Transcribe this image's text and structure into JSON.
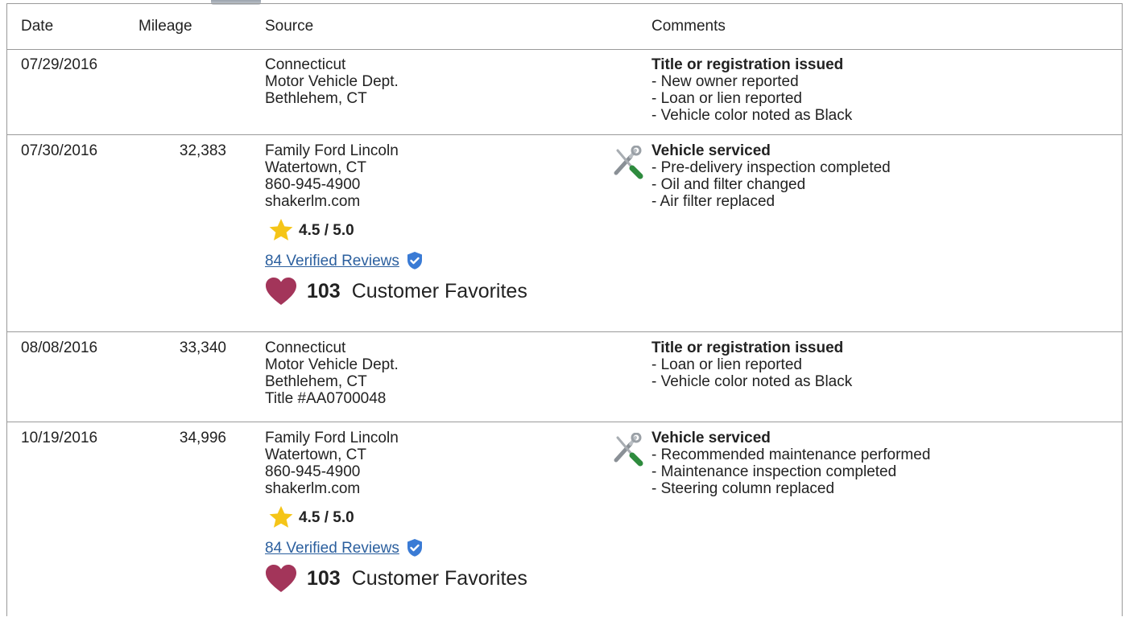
{
  "headers": {
    "date": "Date",
    "mileage": "Mileage",
    "source": "Source",
    "comments": "Comments"
  },
  "records": [
    {
      "date": "07/29/2016",
      "mileage": "",
      "source": [
        "Connecticut",
        "Motor Vehicle Dept.",
        "Bethlehem, CT"
      ],
      "comment_title": "Title or registration issued",
      "comments": [
        "- New owner reported",
        "- Loan or lien reported",
        "- Vehicle color noted as Black"
      ]
    },
    {
      "date": "07/30/2016",
      "mileage": "32,383",
      "source": [
        "Family Ford Lincoln",
        "Watertown, CT",
        "860-945-4900",
        "shakerlm.com"
      ],
      "rating": "4.5 / 5.0",
      "reviews": "84 Verified Reviews",
      "favorites_count": "103",
      "favorites_label": "Customer Favorites",
      "comment_title": "Vehicle serviced",
      "comments": [
        "- Pre-delivery inspection completed",
        "- Oil and filter changed",
        "- Air filter replaced"
      ]
    },
    {
      "date": "08/08/2016",
      "mileage": "33,340",
      "source": [
        "Connecticut",
        "Motor Vehicle Dept.",
        "Bethlehem, CT",
        "Title #AA0700048"
      ],
      "comment_title": "Title or registration issued",
      "comments": [
        "- Loan or lien reported",
        "- Vehicle color noted as Black"
      ]
    },
    {
      "date": "10/19/2016",
      "mileage": "34,996",
      "source": [
        "Family Ford Lincoln",
        "Watertown, CT",
        "860-945-4900",
        "shakerlm.com"
      ],
      "rating": "4.5 / 5.0",
      "reviews": "84 Verified Reviews",
      "favorites_count": "103",
      "favorites_label": "Customer Favorites",
      "comment_title": "Vehicle serviced",
      "comments": [
        "- Recommended maintenance performed",
        "- Maintenance inspection completed",
        "- Steering column replaced"
      ]
    }
  ],
  "icons": {
    "star": "star-icon",
    "shield": "verified-shield-icon",
    "heart": "heart-icon",
    "service": "wrench-screwdriver-icon"
  },
  "colors": {
    "star": "#f5c518",
    "shield": "#3a7bd5",
    "heart": "#a3355a",
    "link": "#2b5f9e",
    "border": "#9a9a9a"
  }
}
